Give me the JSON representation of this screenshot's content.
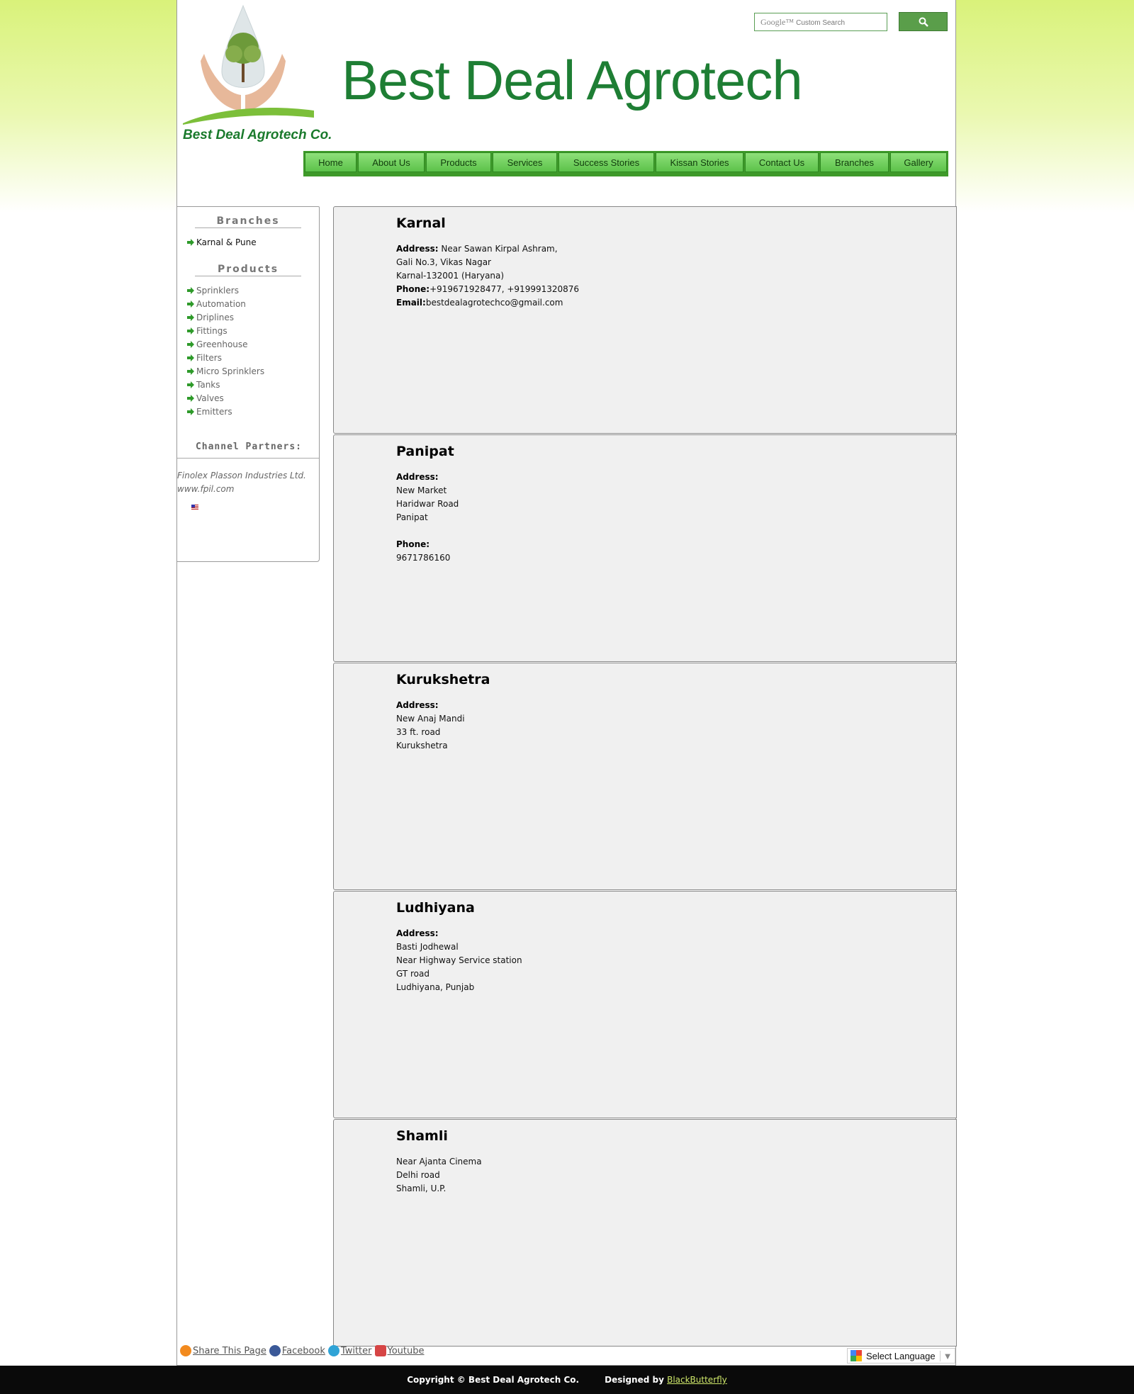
{
  "header": {
    "logo_text": "Best Deal Agrotech Co.",
    "site_title": "Best Deal Agrotech",
    "search": {
      "google_label": "Google™",
      "placeholder": "Custom Search"
    }
  },
  "nav": {
    "items": [
      {
        "label": "Home"
      },
      {
        "label": "About Us"
      },
      {
        "label": "Products"
      },
      {
        "label": "Services"
      },
      {
        "label": "Success Stories"
      },
      {
        "label": "Kissan Stories"
      },
      {
        "label": "Contact Us"
      },
      {
        "label": "Branches"
      },
      {
        "label": "Gallery"
      }
    ]
  },
  "sidebar": {
    "branches_heading": "Branches",
    "branches": [
      "Karnal & Pune"
    ],
    "products_heading": "Products",
    "products": [
      "Sprinklers",
      "Automation",
      "Driplines",
      "Fittings",
      "Greenhouse",
      "Filters",
      "Micro Sprinklers",
      "Tanks",
      "Valves",
      "Emitters"
    ],
    "partners_heading": "Channel Partners:",
    "partner_name": "Finolex Plasson Industries Ltd.",
    "partner_url": "www.fpil.com"
  },
  "branches": [
    {
      "name": "Karnal",
      "address_label": "Address:",
      "address_first": " Near Sawan Kirpal Ashram,",
      "address_rest": [
        "Gali No.3, Vikas Nagar",
        "Karnal-132001 (Haryana)"
      ],
      "phone_label": "Phone:",
      "phone": "+919671928477, +919991320876",
      "email_label": "Email:",
      "email": "bestdealagrotechco@gmail.com"
    },
    {
      "name": "Panipat",
      "address_label": "Address:",
      "lines": [
        "New Market",
        "Haridwar Road",
        "Panipat"
      ],
      "phone_label": "Phone:",
      "phone": "9671786160"
    },
    {
      "name": "Kurukshetra",
      "address_label": "Address:",
      "lines": [
        "New Anaj Mandi",
        "33 ft. road",
        "Kurukshetra"
      ]
    },
    {
      "name": "Ludhiyana",
      "address_label": "Address:",
      "lines": [
        "Basti Jodhewal",
        "Near Highway Service station",
        "GT road",
        "Ludhiyana, Punjab"
      ]
    },
    {
      "name": "Shamli",
      "lines": [
        "Near Ajanta Cinema",
        "Delhi road",
        "Shamli, U.P."
      ]
    }
  ],
  "footer": {
    "share_label": "Share This Page",
    "facebook": "Facebook",
    "twitter": "Twitter",
    "youtube": "Youtube",
    "translate_label": "Select Language",
    "copyright": "Copyright © Best Deal Agrotech Co.",
    "designed_by_label": "Designed by ",
    "designer": "BlackButterfly"
  },
  "colors": {
    "brand_green": "#1e7e34",
    "nav_green": "#5cc24a",
    "bg_gradient_top": "#d9f27a"
  }
}
